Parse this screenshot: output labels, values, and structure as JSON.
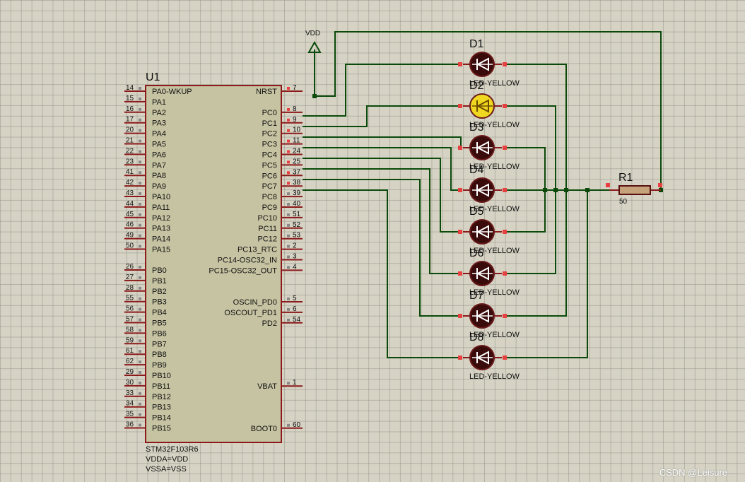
{
  "mcu": {
    "ref": "U1",
    "part": "STM32F103R6",
    "prop1": "VDDA=VDD",
    "prop2": "VSSA=VSS",
    "left_pins": [
      {
        "num": "14",
        "name": "PA0-WKUP"
      },
      {
        "num": "15",
        "name": "PA1"
      },
      {
        "num": "16",
        "name": "PA2"
      },
      {
        "num": "17",
        "name": "PA3"
      },
      {
        "num": "20",
        "name": "PA4"
      },
      {
        "num": "21",
        "name": "PA5"
      },
      {
        "num": "22",
        "name": "PA6"
      },
      {
        "num": "23",
        "name": "PA7"
      },
      {
        "num": "41",
        "name": "PA8"
      },
      {
        "num": "42",
        "name": "PA9"
      },
      {
        "num": "43",
        "name": "PA10"
      },
      {
        "num": "44",
        "name": "PA11"
      },
      {
        "num": "45",
        "name": "PA12"
      },
      {
        "num": "46",
        "name": "PA13"
      },
      {
        "num": "49",
        "name": "PA14"
      },
      {
        "num": "50",
        "name": "PA15"
      },
      {
        "num": "26",
        "name": "PB0"
      },
      {
        "num": "27",
        "name": "PB1"
      },
      {
        "num": "28",
        "name": "PB2"
      },
      {
        "num": "55",
        "name": "PB3"
      },
      {
        "num": "56",
        "name": "PB4"
      },
      {
        "num": "57",
        "name": "PB5"
      },
      {
        "num": "58",
        "name": "PB6"
      },
      {
        "num": "59",
        "name": "PB7"
      },
      {
        "num": "61",
        "name": "PB8"
      },
      {
        "num": "62",
        "name": "PB9"
      },
      {
        "num": "29",
        "name": "PB10"
      },
      {
        "num": "30",
        "name": "PB11"
      },
      {
        "num": "33",
        "name": "PB12"
      },
      {
        "num": "34",
        "name": "PB13"
      },
      {
        "num": "35",
        "name": "PB14"
      },
      {
        "num": "36",
        "name": "PB15"
      }
    ],
    "right_pins": [
      {
        "num": "7",
        "name": "NRST"
      },
      {
        "num": "8",
        "name": "PC0"
      },
      {
        "num": "9",
        "name": "PC1"
      },
      {
        "num": "10",
        "name": "PC2"
      },
      {
        "num": "11",
        "name": "PC3"
      },
      {
        "num": "24",
        "name": "PC4"
      },
      {
        "num": "25",
        "name": "PC5"
      },
      {
        "num": "37",
        "name": "PC6"
      },
      {
        "num": "38",
        "name": "PC7"
      },
      {
        "num": "39",
        "name": "PC8"
      },
      {
        "num": "40",
        "name": "PC9"
      },
      {
        "num": "51",
        "name": "PC10"
      },
      {
        "num": "52",
        "name": "PC11"
      },
      {
        "num": "53",
        "name": "PC12"
      },
      {
        "num": "2",
        "name": "PC13_RTC"
      },
      {
        "num": "3",
        "name": "PC14-OSC32_IN"
      },
      {
        "num": "4",
        "name": "PC15-OSC32_OUT"
      },
      {
        "num": "5",
        "name": "OSCIN_PD0"
      },
      {
        "num": "6",
        "name": "OSCOUT_PD1"
      },
      {
        "num": "54",
        "name": "PD2"
      },
      {
        "num": "1",
        "name": "VBAT"
      },
      {
        "num": "60",
        "name": "BOOT0"
      }
    ]
  },
  "power": {
    "label": "VDD"
  },
  "resistor": {
    "ref": "R1",
    "value": "50"
  },
  "leds": [
    {
      "ref": "D1",
      "type": "LED-YELLOW",
      "lit": false
    },
    {
      "ref": "D2",
      "type": "LED-YELLOW",
      "lit": true
    },
    {
      "ref": "D3",
      "type": "LED-YELLOW",
      "lit": false
    },
    {
      "ref": "D4",
      "type": "LED-YELLOW",
      "lit": false
    },
    {
      "ref": "D5",
      "type": "LED-YELLOW",
      "lit": false
    },
    {
      "ref": "D6",
      "type": "LED-YELLOW",
      "lit": false
    },
    {
      "ref": "D7",
      "type": "LED-YELLOW",
      "lit": false
    },
    {
      "ref": "D8",
      "type": "LED-YELLOW",
      "lit": false
    }
  ],
  "colors": {
    "wire": "#0b4a0b",
    "chip_fill": "#c6c3a2",
    "chip_border": "#8b1a1a",
    "led_off": "#3a0b0b",
    "led_on": "#f0d820",
    "pin_marker": "#e84040"
  },
  "watermark": "CSDN @Leisure…"
}
